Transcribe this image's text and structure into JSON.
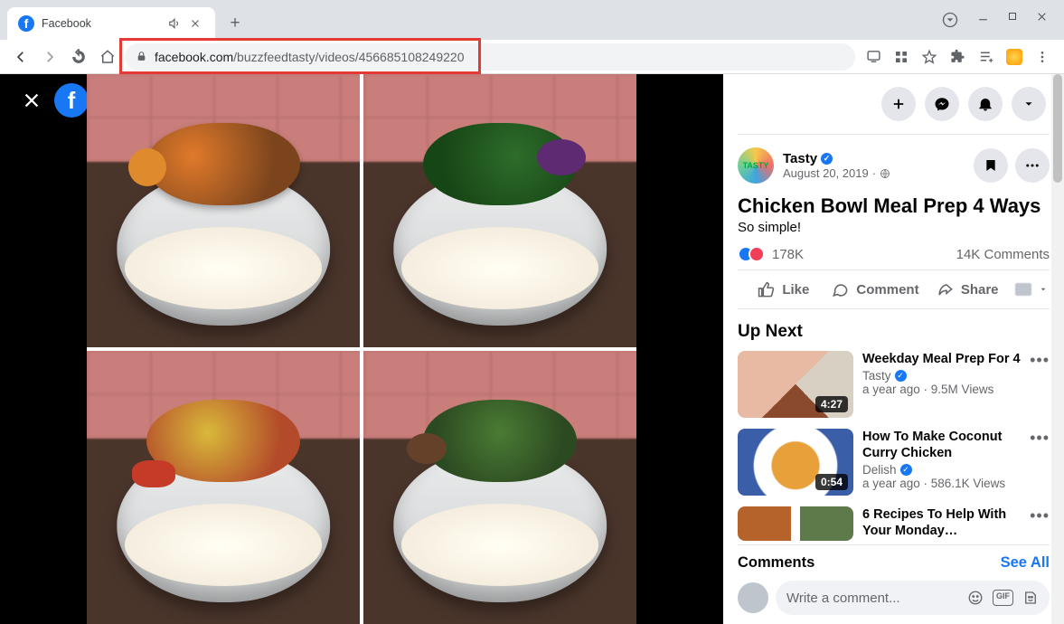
{
  "browser": {
    "tab_title": "Facebook",
    "url_host": "facebook.com",
    "url_path": "/buzzfeedtasty/videos/456685108249220"
  },
  "sidebar": {
    "page_name": "Tasty",
    "post_date": "August 20, 2019",
    "title": "Chicken Bowl Meal Prep 4 Ways",
    "caption": "So simple!",
    "reactions_count": "178K",
    "comments_count": "14K Comments",
    "like_label": "Like",
    "comment_label": "Comment",
    "share_label": "Share",
    "up_next_label": "Up Next",
    "comments_label": "Comments",
    "see_all_label": "See All",
    "comment_placeholder": "Write a comment..."
  },
  "upnext": [
    {
      "title": "Weekday Meal Prep For 4",
      "source": "Tasty",
      "meta": "a year ago · 9.5M Views",
      "duration": "4:27"
    },
    {
      "title": "How To Make Coconut Curry Chicken",
      "source": "Delish",
      "meta": "a year ago · 586.1K Views",
      "duration": "0:54"
    },
    {
      "title": "6 Recipes To Help With Your Monday…",
      "source": "",
      "meta": "",
      "duration": ""
    }
  ]
}
